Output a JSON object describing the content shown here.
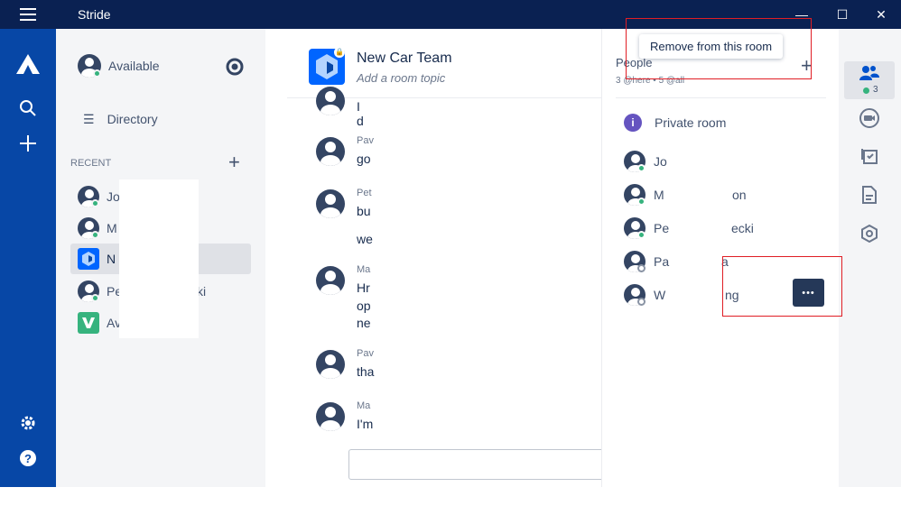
{
  "window": {
    "title": "Stride",
    "controls": [
      "—",
      "☐",
      "✕"
    ]
  },
  "colors": {
    "titlebar": "#0a2152",
    "nav": "#0747a6",
    "sidebar": "#f4f5f7",
    "accent": "#6554c0",
    "online": "#36b37e",
    "highlight": "#e01e25"
  },
  "sidebar": {
    "status": "Available",
    "directory": "Directory",
    "recent_label": "RECENT",
    "recent": [
      {
        "label": "Jo",
        "icon": "avatar-icon",
        "presence": "online"
      },
      {
        "label": "M",
        "icon": "avatar-icon",
        "presence": "online"
      },
      {
        "label": "N",
        "icon": "room-icon",
        "presence": "none",
        "active": true
      },
      {
        "label": "Pe",
        "suffix": "ki",
        "icon": "avatar-icon",
        "presence": "online"
      },
      {
        "label": "Av",
        "icon": "room-icon",
        "presence": "none"
      }
    ]
  },
  "room": {
    "title": "New Car Team",
    "topic": "Add a room topic",
    "messages": [
      {
        "name": "",
        "text": "I d"
      },
      {
        "name": "Pav",
        "text": "go"
      },
      {
        "name": "Pet",
        "text": "bu",
        "text2": "we"
      },
      {
        "name": "Ma",
        "text": "Hr",
        "text2": "op",
        "text3": "ne"
      },
      {
        "name": "Pav",
        "text": "tha"
      },
      {
        "name": "Ma",
        "text": "I'm"
      }
    ]
  },
  "panel": {
    "title": "People",
    "meta": "3 @here • 5 @all",
    "tooltip": "Remove from this room",
    "private_room": "Private room",
    "people": [
      {
        "name": "Jo",
        "presence": "online"
      },
      {
        "name": "M",
        "suffix": "on",
        "presence": "online"
      },
      {
        "name": "Pe",
        "suffix": "ecki",
        "presence": "online"
      },
      {
        "name": "Pa",
        "suffix": "a",
        "presence": "offline"
      },
      {
        "name": "W",
        "suffix": "ng",
        "presence": "offline"
      }
    ],
    "more_button": "•••",
    "people_count": "3"
  }
}
